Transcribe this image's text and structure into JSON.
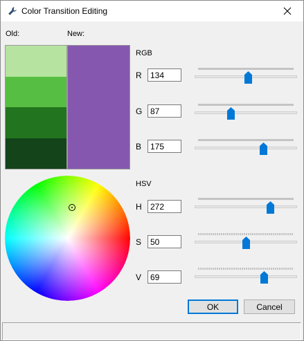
{
  "window": {
    "title": "Color Transition Editing"
  },
  "labels": {
    "old": "Old:",
    "new": "New:",
    "rgb": "RGB",
    "hsv": "HSV"
  },
  "old_swatches": [
    "#b6e4a0",
    "#56be42",
    "#23741e",
    "#13441a"
  ],
  "new_color": "#8657af",
  "channels": {
    "r": {
      "label": "R",
      "value": "134",
      "fraction": 0.525
    },
    "g": {
      "label": "G",
      "value": "87",
      "fraction": 0.341
    },
    "b": {
      "label": "B",
      "value": "175",
      "fraction": 0.686
    },
    "h": {
      "label": "H",
      "value": "272",
      "fraction": 0.756
    },
    "s": {
      "label": "S",
      "value": "50",
      "fraction": 0.5
    },
    "v": {
      "label": "V",
      "value": "69",
      "fraction": 0.69
    }
  },
  "buttons": {
    "ok": "OK",
    "cancel": "Cancel"
  },
  "colors": {
    "accent": "#0078d7",
    "window_bg": "#f0f0f0"
  }
}
